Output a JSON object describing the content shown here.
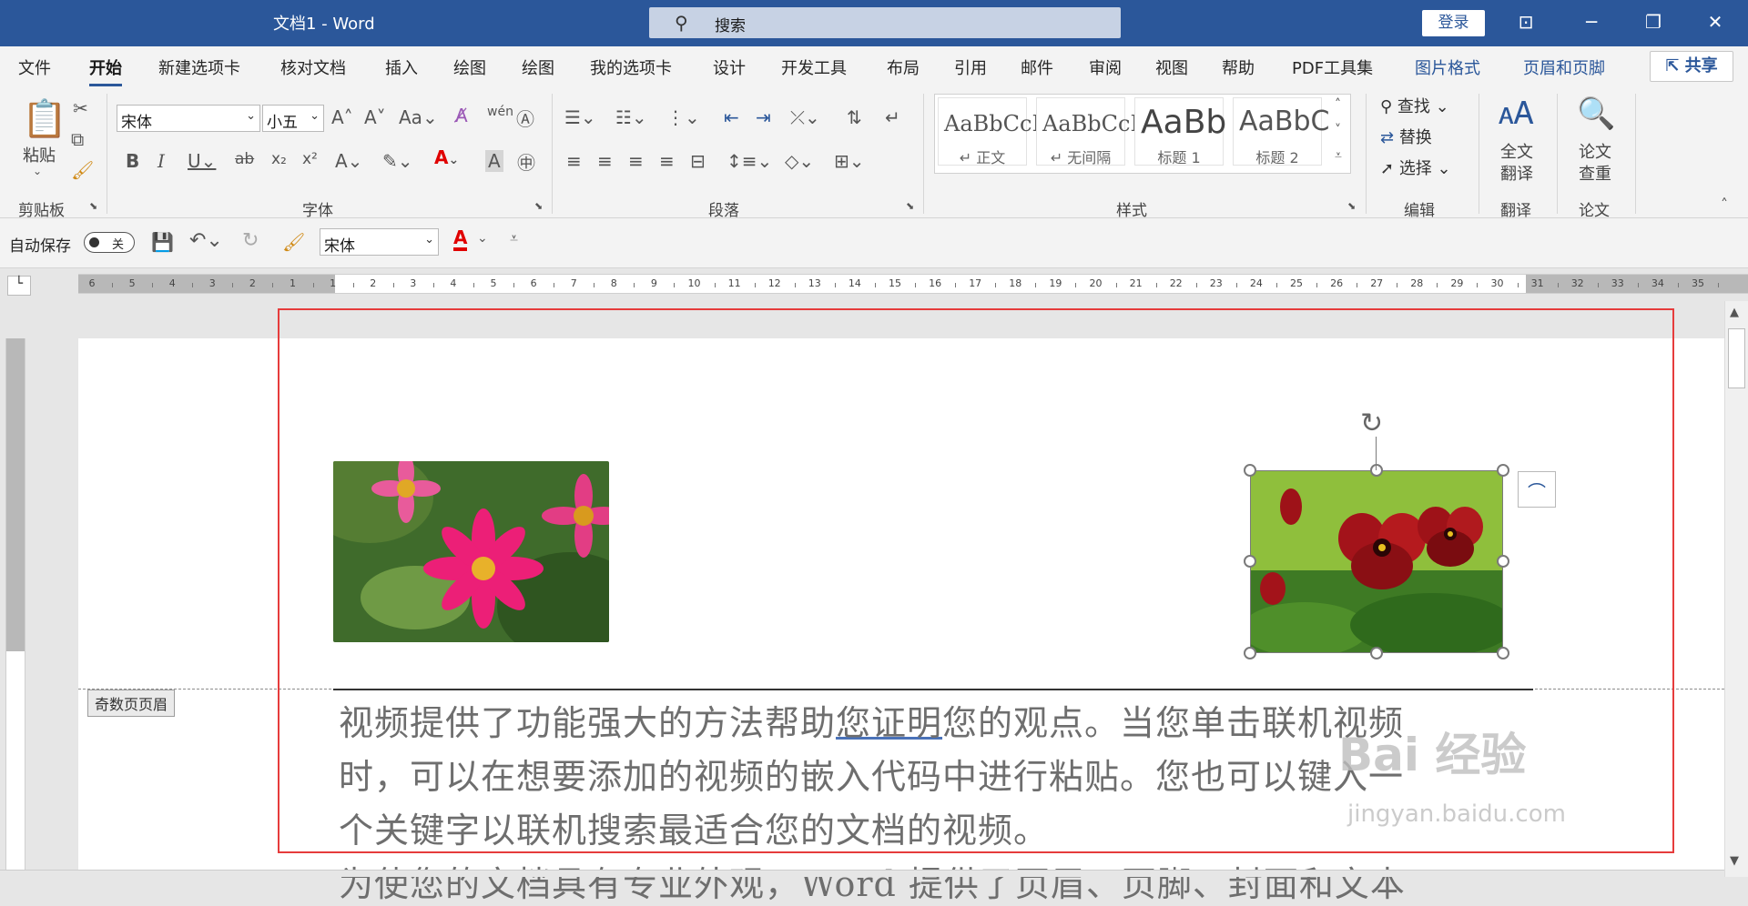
{
  "window": {
    "title": "文档1  -  Word",
    "search_label": "搜索",
    "login_label": "登录"
  },
  "menu": {
    "tabs": [
      "文件",
      "开始",
      "新建选项卡",
      "核对文档",
      "插入",
      "绘图",
      "绘图",
      "我的选项卡",
      "设计",
      "开发工具",
      "布局",
      "引用",
      "邮件",
      "审阅",
      "视图",
      "帮助",
      "PDF工具集",
      "图片格式",
      "页眉和页脚"
    ],
    "share_label": "共享"
  },
  "ribbon": {
    "clipboard": {
      "paste_label": "粘贴",
      "group_label": "剪贴板"
    },
    "font": {
      "font_name": "宋体",
      "font_size": "小五",
      "group_label": "字体",
      "aa_label": "Aa"
    },
    "paragraph": {
      "group_label": "段落"
    },
    "styles": {
      "group_label": "样式",
      "items": [
        {
          "preview": "AaBbCcI",
          "name": "↵ 正文"
        },
        {
          "preview": "AaBbCcI",
          "name": "↵ 无间隔"
        },
        {
          "preview": "AaBb",
          "name": "标题 1"
        },
        {
          "preview": "AaBbC",
          "name": "标题 2"
        }
      ]
    },
    "editing": {
      "find_label": "查找",
      "replace_label": "替换",
      "select_label": "选择",
      "group_label": "编辑"
    },
    "translate": {
      "button_label_1": "全文",
      "button_label_2": "翻译",
      "group_label": "翻译"
    },
    "paper": {
      "button_label_1": "论文",
      "button_label_2": "查重",
      "group_label": "论文"
    }
  },
  "qat": {
    "autosave_label": "自动保存",
    "autosave_state": "关",
    "font_name": "宋体"
  },
  "ruler": {
    "numbers": [
      "6",
      "5",
      "4",
      "3",
      "2",
      "1",
      "1",
      "2",
      "3",
      "4",
      "5",
      "6",
      "7",
      "8",
      "9",
      "10",
      "11",
      "12",
      "13",
      "14",
      "15",
      "16",
      "17",
      "18",
      "19",
      "20",
      "21",
      "22",
      "23",
      "24",
      "25",
      "26",
      "27",
      "28",
      "29",
      "30",
      "31",
      "32",
      "33",
      "34",
      "35"
    ]
  },
  "document": {
    "header_label": "奇数页页眉",
    "line1_before": "视频提供了功能强大的方法帮助",
    "line1_link": "您证明",
    "line1_after": "您的观点。当您单击联机视频",
    "line2": "时，可以在想要添加的视频的嵌入代码中进行粘贴。您也可以键入一",
    "line3": "个关键字以联机搜索最适合您的文档的视频。",
    "line4": "为使您的文档具有专业外观，Word 提供了页眉、页脚、封面和文本"
  },
  "watermark": {
    "text": "Bai 经验",
    "subtext": "jingyan.baidu.com"
  },
  "colors": {
    "accent": "#2b579a",
    "highlight_box": "#e63c3c",
    "font_color_red": "#e00000"
  }
}
